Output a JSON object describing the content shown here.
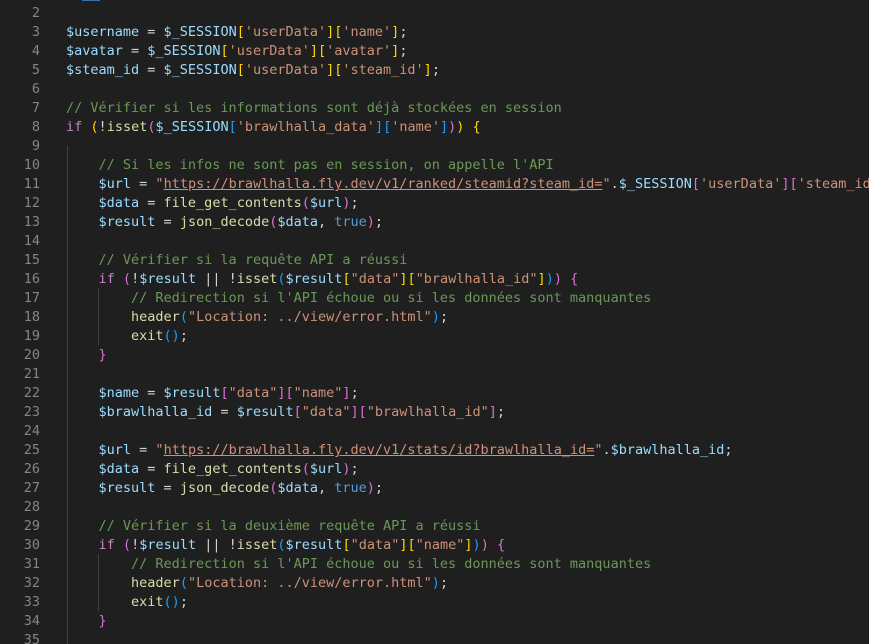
{
  "editor": {
    "theme": {
      "background": "#1f1f1f",
      "variable": "#9cdcfe",
      "string": "#ce9178",
      "function": "#dcdcaa",
      "keyword": "#c586c0",
      "comment": "#6a9955",
      "constant": "#569cd6"
    },
    "lines": [
      {
        "n": "2",
        "tokens": []
      },
      {
        "n": "3",
        "tokens": [
          [
            "v",
            "$username"
          ],
          [
            "p",
            " = "
          ],
          [
            "v",
            "$_SESSION"
          ],
          [
            "br1",
            "["
          ],
          [
            "s",
            "'userData'"
          ],
          [
            "br1",
            "]["
          ],
          [
            "s",
            "'name'"
          ],
          [
            "br1",
            "]"
          ],
          [
            "p",
            ";"
          ]
        ]
      },
      {
        "n": "4",
        "tokens": [
          [
            "v",
            "$avatar"
          ],
          [
            "p",
            " = "
          ],
          [
            "v",
            "$_SESSION"
          ],
          [
            "br1",
            "["
          ],
          [
            "s",
            "'userData'"
          ],
          [
            "br1",
            "]["
          ],
          [
            "s",
            "'avatar'"
          ],
          [
            "br1",
            "]"
          ],
          [
            "p",
            ";"
          ]
        ]
      },
      {
        "n": "5",
        "tokens": [
          [
            "v",
            "$steam_id"
          ],
          [
            "p",
            " = "
          ],
          [
            "v",
            "$_SESSION"
          ],
          [
            "br1",
            "["
          ],
          [
            "s",
            "'userData'"
          ],
          [
            "br1",
            "]["
          ],
          [
            "s",
            "'steam_id'"
          ],
          [
            "br1",
            "]"
          ],
          [
            "p",
            ";"
          ]
        ]
      },
      {
        "n": "6",
        "tokens": []
      },
      {
        "n": "7",
        "tokens": [
          [
            "c",
            "// Vérifier si les informations sont déjà stockées en session"
          ]
        ]
      },
      {
        "n": "8",
        "tokens": [
          [
            "k",
            "if"
          ],
          [
            "p",
            " "
          ],
          [
            "br1",
            "("
          ],
          [
            "p",
            "!"
          ],
          [
            "f",
            "isset"
          ],
          [
            "br2",
            "("
          ],
          [
            "v",
            "$_SESSION"
          ],
          [
            "br3",
            "["
          ],
          [
            "s",
            "'brawlhalla_data'"
          ],
          [
            "br3",
            "]["
          ],
          [
            "s",
            "'name'"
          ],
          [
            "br3",
            "]"
          ],
          [
            "br2",
            ")"
          ],
          [
            "br1",
            ")"
          ],
          [
            "p",
            " "
          ],
          [
            "br1",
            "{"
          ]
        ]
      },
      {
        "n": "9",
        "tokens": []
      },
      {
        "n": "10",
        "tokens": [
          [
            "p",
            "    "
          ],
          [
            "c",
            "// Si les infos ne sont pas en session, on appelle l'API"
          ]
        ]
      },
      {
        "n": "11",
        "tokens": [
          [
            "p",
            "    "
          ],
          [
            "v",
            "$url"
          ],
          [
            "p",
            " = "
          ],
          [
            "s",
            "\""
          ],
          [
            "su",
            "https://brawlhalla.fly.dev/v1/ranked/steamid?steam_id="
          ],
          [
            "s",
            "\""
          ],
          [
            "p",
            "."
          ],
          [
            "v",
            "$_SESSION"
          ],
          [
            "br2",
            "["
          ],
          [
            "s",
            "'userData'"
          ],
          [
            "br2",
            "]["
          ],
          [
            "s",
            "'steam_id'"
          ],
          [
            "br2",
            "]"
          ],
          [
            "p",
            ";"
          ]
        ]
      },
      {
        "n": "12",
        "tokens": [
          [
            "p",
            "    "
          ],
          [
            "v",
            "$data"
          ],
          [
            "p",
            " = "
          ],
          [
            "f",
            "file_get_contents"
          ],
          [
            "br2",
            "("
          ],
          [
            "v",
            "$url"
          ],
          [
            "br2",
            ")"
          ],
          [
            "p",
            ";"
          ]
        ]
      },
      {
        "n": "13",
        "tokens": [
          [
            "p",
            "    "
          ],
          [
            "v",
            "$result"
          ],
          [
            "p",
            " = "
          ],
          [
            "f",
            "json_decode"
          ],
          [
            "br2",
            "("
          ],
          [
            "v",
            "$data"
          ],
          [
            "p",
            ", "
          ],
          [
            "b",
            "true"
          ],
          [
            "br2",
            ")"
          ],
          [
            "p",
            ";"
          ]
        ]
      },
      {
        "n": "14",
        "tokens": []
      },
      {
        "n": "15",
        "tokens": [
          [
            "p",
            "    "
          ],
          [
            "c",
            "// Vérifier si la requête API a réussi"
          ]
        ]
      },
      {
        "n": "16",
        "tokens": [
          [
            "p",
            "    "
          ],
          [
            "k",
            "if"
          ],
          [
            "p",
            " "
          ],
          [
            "br2",
            "("
          ],
          [
            "p",
            "!"
          ],
          [
            "v",
            "$result"
          ],
          [
            "p",
            " || !"
          ],
          [
            "f",
            "isset"
          ],
          [
            "br3",
            "("
          ],
          [
            "v",
            "$result"
          ],
          [
            "br1",
            "["
          ],
          [
            "s",
            "\"data\""
          ],
          [
            "br1",
            "]["
          ],
          [
            "s",
            "\"brawlhalla_id\""
          ],
          [
            "br1",
            "]"
          ],
          [
            "br3",
            ")"
          ],
          [
            "br2",
            ")"
          ],
          [
            "p",
            " "
          ],
          [
            "br2",
            "{"
          ]
        ]
      },
      {
        "n": "17",
        "tokens": [
          [
            "p",
            "        "
          ],
          [
            "c",
            "// Redirection si l'API échoue ou si les données sont manquantes"
          ]
        ]
      },
      {
        "n": "18",
        "tokens": [
          [
            "p",
            "        "
          ],
          [
            "f",
            "header"
          ],
          [
            "br3",
            "("
          ],
          [
            "s",
            "\"Location: ../view/error.html\""
          ],
          [
            "br3",
            ")"
          ],
          [
            "p",
            ";"
          ]
        ]
      },
      {
        "n": "19",
        "tokens": [
          [
            "p",
            "        "
          ],
          [
            "f",
            "exit"
          ],
          [
            "br3",
            "()"
          ],
          [
            "p",
            ";"
          ]
        ]
      },
      {
        "n": "20",
        "tokens": [
          [
            "p",
            "    "
          ],
          [
            "br2",
            "}"
          ]
        ]
      },
      {
        "n": "21",
        "tokens": []
      },
      {
        "n": "22",
        "tokens": [
          [
            "p",
            "    "
          ],
          [
            "v",
            "$name"
          ],
          [
            "p",
            " = "
          ],
          [
            "v",
            "$result"
          ],
          [
            "br2",
            "["
          ],
          [
            "s",
            "\"data\""
          ],
          [
            "br2",
            "]["
          ],
          [
            "s",
            "\"name\""
          ],
          [
            "br2",
            "]"
          ],
          [
            "p",
            ";"
          ]
        ]
      },
      {
        "n": "23",
        "tokens": [
          [
            "p",
            "    "
          ],
          [
            "v",
            "$brawlhalla_id"
          ],
          [
            "p",
            " = "
          ],
          [
            "v",
            "$result"
          ],
          [
            "br2",
            "["
          ],
          [
            "s",
            "\"data\""
          ],
          [
            "br2",
            "]["
          ],
          [
            "s",
            "\"brawlhalla_id\""
          ],
          [
            "br2",
            "]"
          ],
          [
            "p",
            ";"
          ]
        ]
      },
      {
        "n": "24",
        "tokens": []
      },
      {
        "n": "25",
        "tokens": [
          [
            "p",
            "    "
          ],
          [
            "v",
            "$url"
          ],
          [
            "p",
            " = "
          ],
          [
            "s",
            "\""
          ],
          [
            "su",
            "https://brawlhalla.fly.dev/v1/stats/id?brawlhalla_id="
          ],
          [
            "s",
            "\""
          ],
          [
            "p",
            "."
          ],
          [
            "v",
            "$brawlhalla_id"
          ],
          [
            "p",
            ";"
          ]
        ]
      },
      {
        "n": "26",
        "tokens": [
          [
            "p",
            "    "
          ],
          [
            "v",
            "$data"
          ],
          [
            "p",
            " = "
          ],
          [
            "f",
            "file_get_contents"
          ],
          [
            "br2",
            "("
          ],
          [
            "v",
            "$url"
          ],
          [
            "br2",
            ")"
          ],
          [
            "p",
            ";"
          ]
        ]
      },
      {
        "n": "27",
        "tokens": [
          [
            "p",
            "    "
          ],
          [
            "v",
            "$result"
          ],
          [
            "p",
            " = "
          ],
          [
            "f",
            "json_decode"
          ],
          [
            "br2",
            "("
          ],
          [
            "v",
            "$data"
          ],
          [
            "p",
            ", "
          ],
          [
            "b",
            "true"
          ],
          [
            "br2",
            ")"
          ],
          [
            "p",
            ";"
          ]
        ]
      },
      {
        "n": "28",
        "tokens": []
      },
      {
        "n": "29",
        "tokens": [
          [
            "p",
            "    "
          ],
          [
            "c",
            "// Vérifier si la deuxième requête API a réussi"
          ]
        ]
      },
      {
        "n": "30",
        "tokens": [
          [
            "p",
            "    "
          ],
          [
            "k",
            "if"
          ],
          [
            "p",
            " "
          ],
          [
            "br2",
            "("
          ],
          [
            "p",
            "!"
          ],
          [
            "v",
            "$result"
          ],
          [
            "p",
            " || !"
          ],
          [
            "f",
            "isset"
          ],
          [
            "br3",
            "("
          ],
          [
            "v",
            "$result"
          ],
          [
            "br1",
            "["
          ],
          [
            "s",
            "\"data\""
          ],
          [
            "br1",
            "]["
          ],
          [
            "s",
            "\"name\""
          ],
          [
            "br1",
            "]"
          ],
          [
            "br3",
            ")"
          ],
          [
            "br2",
            ")"
          ],
          [
            "p",
            " "
          ],
          [
            "br2",
            "{"
          ]
        ]
      },
      {
        "n": "31",
        "tokens": [
          [
            "p",
            "        "
          ],
          [
            "c",
            "// Redirection si l'API échoue ou si les données sont manquantes"
          ]
        ]
      },
      {
        "n": "32",
        "tokens": [
          [
            "p",
            "        "
          ],
          [
            "f",
            "header"
          ],
          [
            "br3",
            "("
          ],
          [
            "s",
            "\"Location: ../view/error.html\""
          ],
          [
            "br3",
            ")"
          ],
          [
            "p",
            ";"
          ]
        ]
      },
      {
        "n": "33",
        "tokens": [
          [
            "p",
            "        "
          ],
          [
            "f",
            "exit"
          ],
          [
            "br3",
            "()"
          ],
          [
            "p",
            ";"
          ]
        ]
      },
      {
        "n": "34",
        "tokens": [
          [
            "p",
            "    "
          ],
          [
            "br2",
            "}"
          ]
        ]
      },
      {
        "n": "35",
        "tokens": []
      }
    ]
  }
}
